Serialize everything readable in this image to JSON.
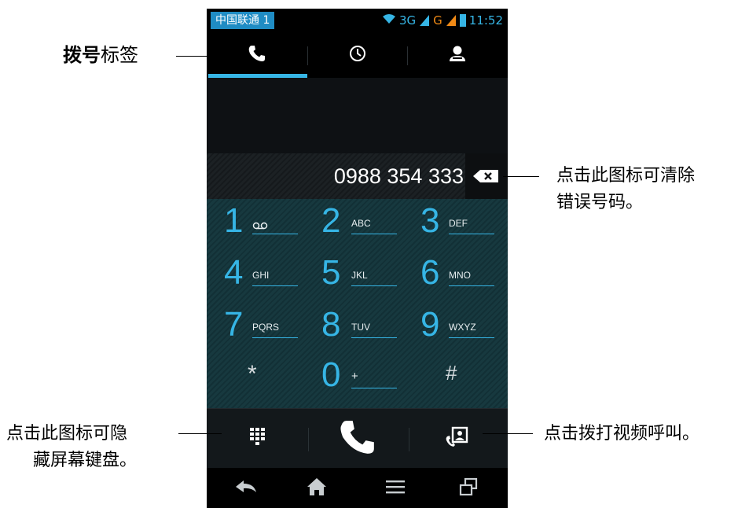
{
  "status_bar": {
    "carrier": "中国联通 1",
    "network": "3G",
    "network2": "G",
    "time": "11:52",
    "colors": {
      "accent": "#36b5e5",
      "g_signal": "#f08a16"
    }
  },
  "tabs": [
    {
      "icon": "phone-icon",
      "active": true
    },
    {
      "icon": "clock-icon",
      "active": false
    },
    {
      "icon": "person-icon",
      "active": false
    }
  ],
  "dial_number": "0988 354 333",
  "keys": [
    {
      "digit": "1",
      "letters": ""
    },
    {
      "digit": "2",
      "letters": "ABC"
    },
    {
      "digit": "3",
      "letters": "DEF"
    },
    {
      "digit": "4",
      "letters": "GHI"
    },
    {
      "digit": "5",
      "letters": "JKL"
    },
    {
      "digit": "6",
      "letters": "MNO"
    },
    {
      "digit": "7",
      "letters": "PQRS"
    },
    {
      "digit": "8",
      "letters": "TUV"
    },
    {
      "digit": "9",
      "letters": "WXYZ"
    },
    {
      "digit": "*",
      "letters": ""
    },
    {
      "digit": "0",
      "letters": "+"
    },
    {
      "digit": "#",
      "letters": ""
    }
  ],
  "annotations": {
    "tab_label_bold": "拨号",
    "tab_label_rest": "标签",
    "delete_line1": "点击此图标可清除",
    "delete_line2": "错误号码。",
    "keypad_line1": "点击此图标可隐",
    "keypad_line2": "藏屏幕键盘。",
    "video_call": "点击拨打视频呼叫。"
  }
}
